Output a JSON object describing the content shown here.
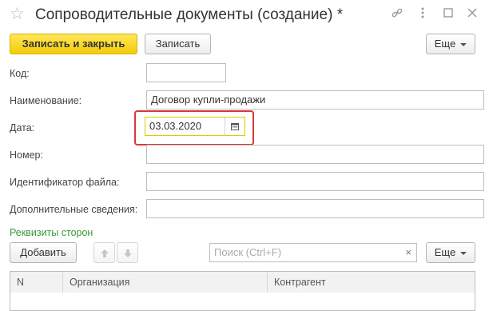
{
  "window": {
    "title": "Сопроводительные документы (создание) *",
    "star_icon": "star-icon",
    "link_icon": "link-icon",
    "more_icon": "more-vertical-icon",
    "maximize_icon": "maximize-icon",
    "close_icon": "close-icon"
  },
  "toolbar": {
    "save_close_label": "Записать и закрыть",
    "save_label": "Записать",
    "more_label": "Еще"
  },
  "form": {
    "code_label": "Код:",
    "code_value": "",
    "name_label": "Наименование:",
    "name_value": "Договор купли-продажи",
    "date_label": "Дата:",
    "date_value": "03.03.2020",
    "number_label": "Номер:",
    "number_value": "",
    "file_id_label": "Идентификатор файла:",
    "file_id_value": "",
    "extra_label": "Дополнительные сведения:",
    "extra_value": ""
  },
  "requisites": {
    "section_title": "Реквизиты сторон",
    "add_label": "Добавить",
    "search_placeholder": "Поиск (Ctrl+F)",
    "more_label": "Еще",
    "columns": [
      "N",
      "Организация",
      "Контрагент"
    ]
  },
  "colors": {
    "primary_button": "#f4cc07",
    "highlight": "#d9363e",
    "section_title": "#3a9a3a"
  }
}
